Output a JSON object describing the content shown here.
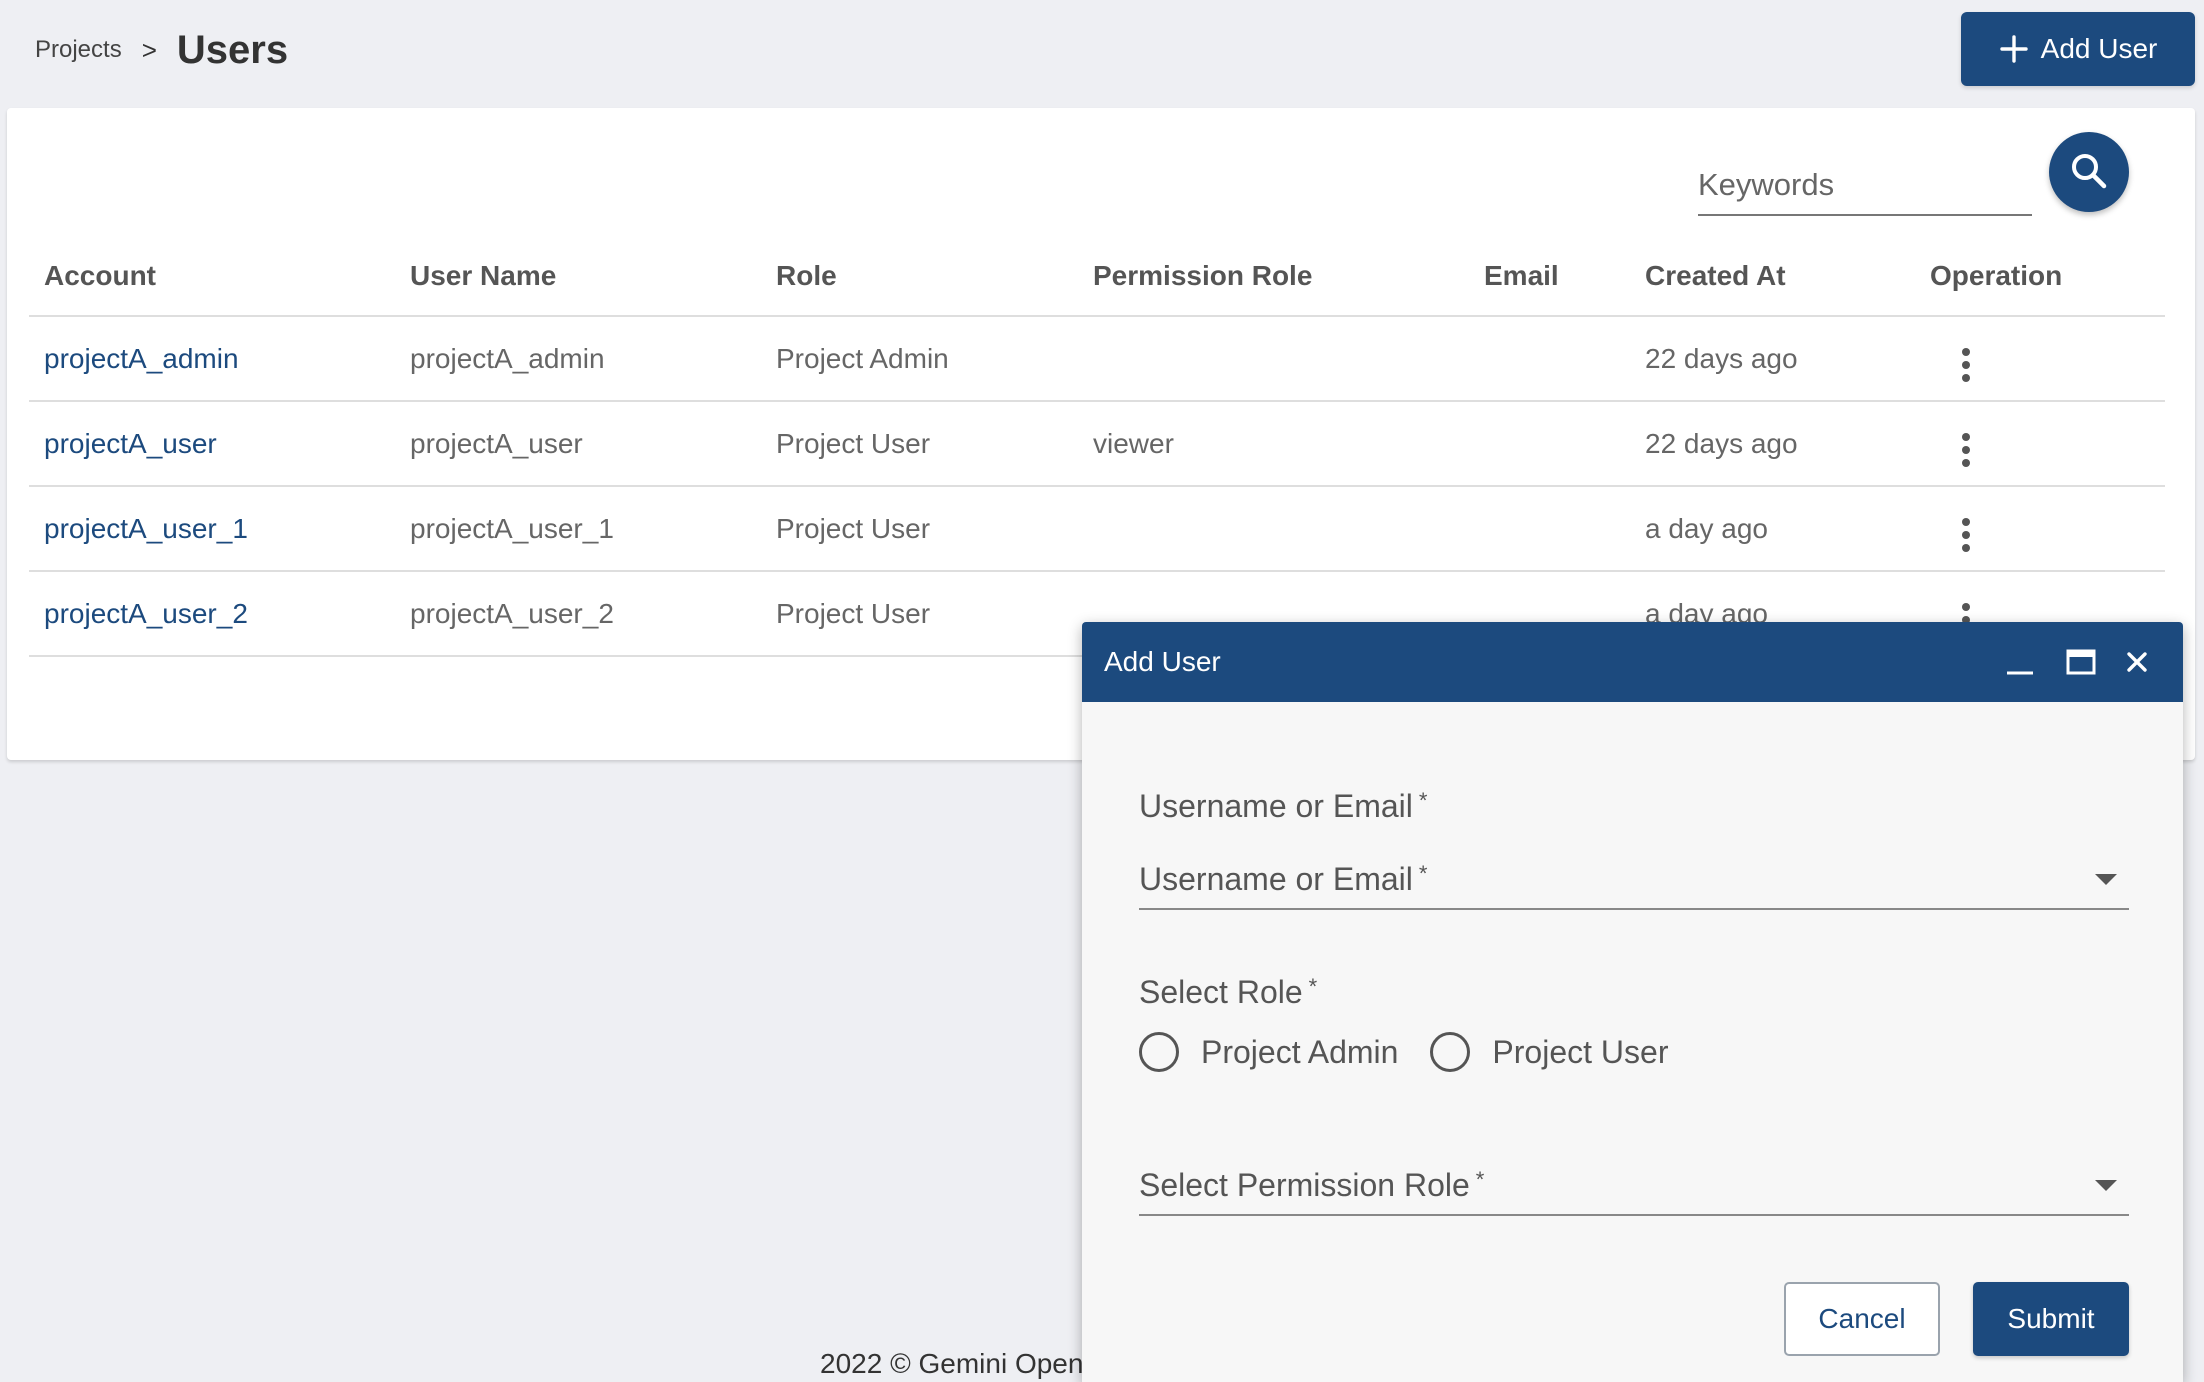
{
  "breadcrumb": {
    "parent": "Projects",
    "separator": ">",
    "current": "Users"
  },
  "header": {
    "add_user_label": "Add User"
  },
  "search": {
    "placeholder": "Keywords"
  },
  "table": {
    "columns": [
      "Account",
      "User Name",
      "Role",
      "Permission Role",
      "Email",
      "Created At",
      "Operation"
    ],
    "rows": [
      {
        "account": "projectA_admin",
        "user_name": "projectA_admin",
        "role": "Project Admin",
        "permission_role": "",
        "email": "",
        "created_at": "22 days ago"
      },
      {
        "account": "projectA_user",
        "user_name": "projectA_user",
        "role": "Project User",
        "permission_role": "viewer",
        "email": "",
        "created_at": "22 days ago"
      },
      {
        "account": "projectA_user_1",
        "user_name": "projectA_user_1",
        "role": "Project User",
        "permission_role": "",
        "email": "",
        "created_at": "a day ago"
      },
      {
        "account": "projectA_user_2",
        "user_name": "projectA_user_2",
        "role": "Project User",
        "permission_role": "",
        "email": "",
        "created_at": "a day ago"
      }
    ]
  },
  "footer": {
    "text": "2022 © Gemini Open"
  },
  "dialog": {
    "title": "Add User",
    "username_label": "Username or Email",
    "username_placeholder": "Username or Email",
    "required_mark": "*",
    "role_label": "Select Role",
    "role_options": [
      "Project Admin",
      "Project User"
    ],
    "permission_placeholder": "Select Permission Role",
    "cancel_label": "Cancel",
    "submit_label": "Submit"
  },
  "colors": {
    "primary": "#1c4a7e",
    "background": "#eeeff3",
    "card": "#ffffff"
  },
  "icons": [
    "plus-icon",
    "search-icon",
    "more-vert-icon",
    "minimize-icon",
    "maximize-icon",
    "close-icon",
    "caret-down-icon"
  ]
}
